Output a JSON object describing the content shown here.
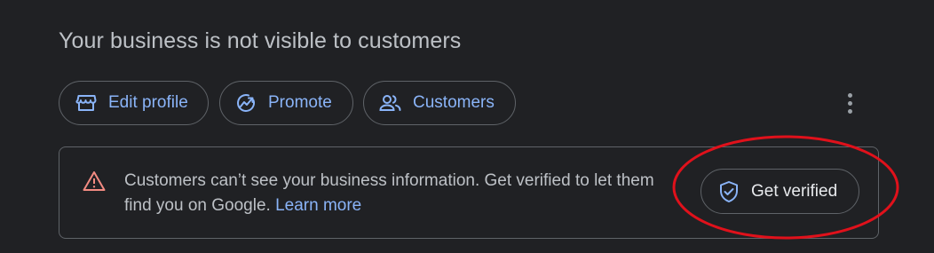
{
  "header": {
    "title": "Your business is not visible to customers"
  },
  "actions": {
    "edit_profile": "Edit profile",
    "promote": "Promote",
    "customers": "Customers"
  },
  "banner": {
    "message": "Customers can’t see your business information. Get verified to let them find you on Google.",
    "learn_more": "Learn more",
    "verify_button": "Get verified"
  },
  "annotation": {
    "shape": "ellipse",
    "color": "#e0111b"
  },
  "colors": {
    "background": "#202124",
    "accent": "#8ab4f8",
    "warning": "#f28b82",
    "border": "#5f6368"
  }
}
